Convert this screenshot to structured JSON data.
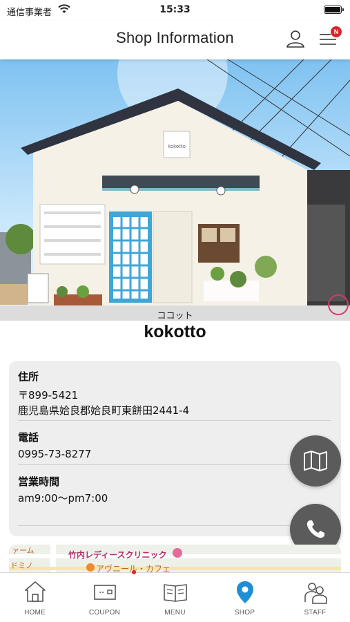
{
  "status_bar": {
    "carrier": "通信事業者",
    "time": "15:33"
  },
  "header": {
    "title": "Shop Information",
    "menu_badge": "N"
  },
  "shop": {
    "name_kana": "ココット",
    "name": "kokotto",
    "sign_text": "kokotto"
  },
  "info": {
    "address": {
      "label": "住所",
      "postal": "〒899-5421",
      "line": "鹿児島県姶良郡姶良町東餅田2441-4"
    },
    "phone": {
      "label": "電話",
      "value": "0995-73-8277"
    },
    "hours": {
      "label": "営業時間",
      "value": "am9:00〜pm7:00"
    }
  },
  "map": {
    "labels": [
      "ァーム",
      "竹内レディースクリニック",
      "ドミノ",
      "アヴニール・カフェ"
    ]
  },
  "tabbar": {
    "tabs": [
      {
        "label": "HOME",
        "icon": "home-icon"
      },
      {
        "label": "COUPON",
        "icon": "coupon-icon"
      },
      {
        "label": "MENU",
        "icon": "menu-book-icon"
      },
      {
        "label": "SHOP",
        "icon": "location-pin-icon"
      },
      {
        "label": "STAFF",
        "icon": "staff-icon"
      }
    ],
    "active": "SHOP",
    "accent_color": "#1e8fd5"
  },
  "colors": {
    "fab": "#5b5b5b",
    "badge": "#d9252a",
    "card": "#eeeeee"
  }
}
